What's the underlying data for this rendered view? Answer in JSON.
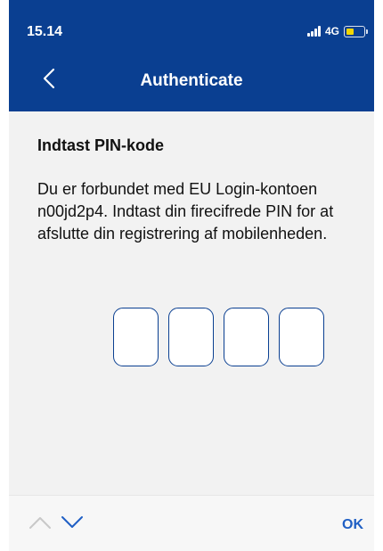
{
  "status_bar": {
    "time": "15.14",
    "network": "4G",
    "battery_color": "#f2d600"
  },
  "nav_bar": {
    "title": "Authenticate",
    "back_icon": "chevron-left-icon",
    "background": "#0a3f91"
  },
  "content": {
    "heading": "Indtast PIN-kode",
    "message": "Du er forbundet med EU Login-kontoen n00jd2p4. Indtast din firecifrede PIN for at afslutte din registrering af mobilenheden.",
    "pin_digits": [
      "",
      "",
      "",
      ""
    ]
  },
  "keyboard_toolbar": {
    "prev_icon": "chevron-up-icon",
    "next_icon": "chevron-down-icon",
    "ok_label": "OK",
    "accent": "#1f5fc4"
  }
}
